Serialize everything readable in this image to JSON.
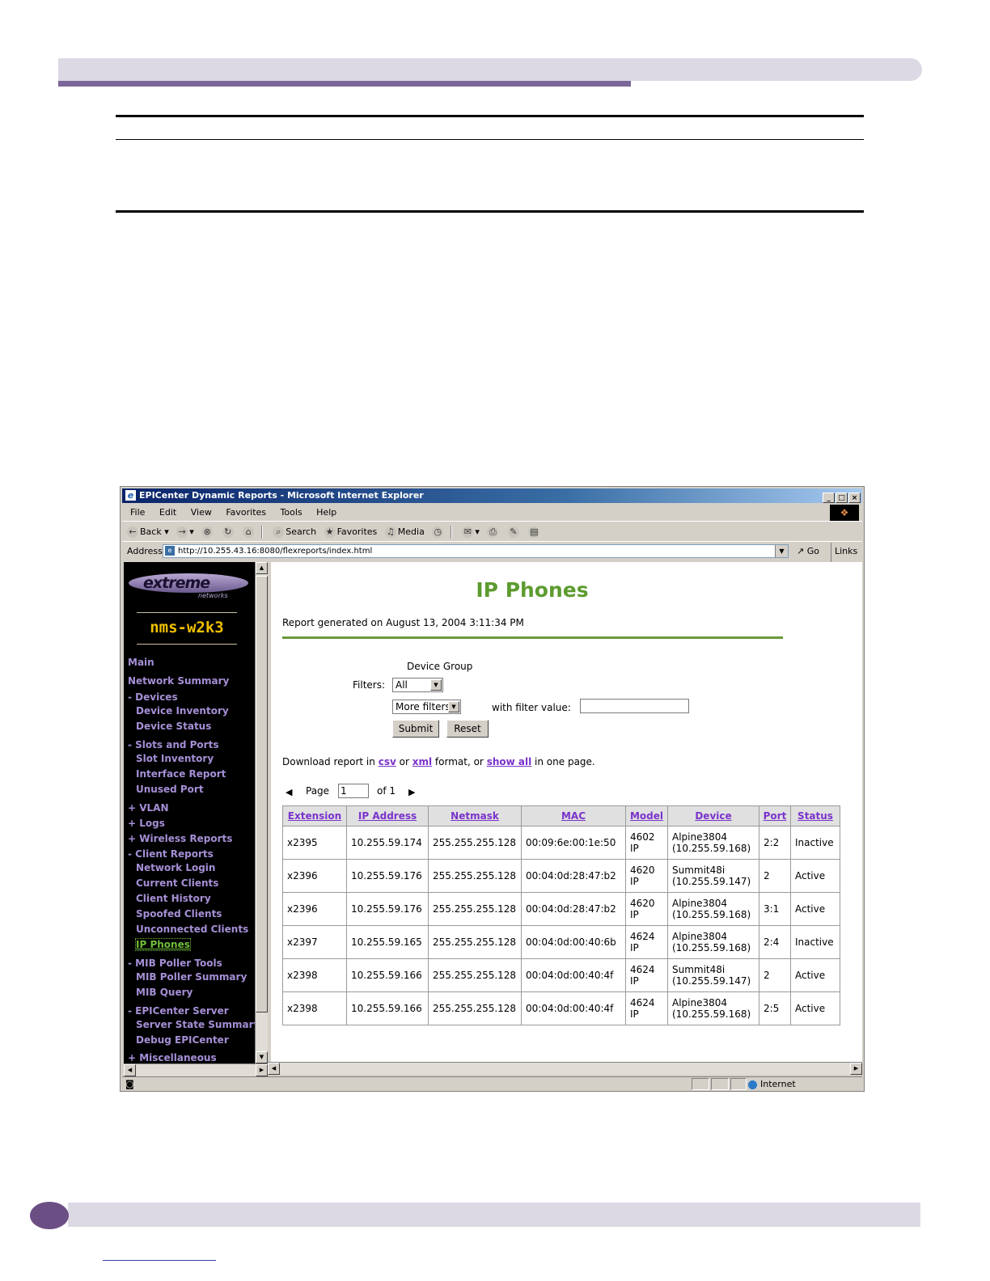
{
  "window": {
    "title": "EPICenter Dynamic Reports - Microsoft Internet Explorer"
  },
  "menu": [
    "File",
    "Edit",
    "View",
    "Favorites",
    "Tools",
    "Help"
  ],
  "toolbar": {
    "back": "Back",
    "search": "Search",
    "favorites": "Favorites",
    "media": "Media"
  },
  "address": {
    "label": "Address",
    "url": "http://10.255.43.16:8080/flexreports/index.html",
    "go": "Go",
    "links": "Links"
  },
  "sidebar": {
    "logo": "extreme",
    "logo_sub": "networks",
    "host": "nms-w2k3",
    "items": [
      {
        "label": "Main"
      },
      {
        "label": "Network Summary"
      },
      {
        "label": "- Devices"
      },
      {
        "label": "Device Inventory"
      },
      {
        "label": "Device Status"
      },
      {
        "label": "- Slots and Ports"
      },
      {
        "label": "Slot Inventory"
      },
      {
        "label": "Interface Report"
      },
      {
        "label": "Unused Port"
      },
      {
        "label": "+ VLAN"
      },
      {
        "label": "+ Logs"
      },
      {
        "label": "+ Wireless Reports"
      },
      {
        "label": "- Client Reports"
      },
      {
        "label": "Network Login"
      },
      {
        "label": "Current Clients"
      },
      {
        "label": "Client History"
      },
      {
        "label": "Spoofed Clients"
      },
      {
        "label": "Unconnected Clients"
      },
      {
        "label": "IP Phones"
      },
      {
        "label": "- MIB Poller Tools"
      },
      {
        "label": "MIB Poller Summary"
      },
      {
        "label": "MIB Query"
      },
      {
        "label": "- EPICenter Server"
      },
      {
        "label": "Server State Summary"
      },
      {
        "label": "Debug EPICenter"
      },
      {
        "label": "+ Miscellaneous"
      }
    ]
  },
  "report": {
    "title": "IP Phones",
    "generated": "Report generated on August 13, 2004 3:11:34 PM",
    "device_group_label": "Device Group",
    "filters_label": "Filters:",
    "filter_value": "All",
    "more_filters": "More filters",
    "with_filter_value": "with filter value:",
    "submit": "Submit",
    "reset": "Reset",
    "download_prefix": "Download report in",
    "csv": "csv",
    "or1": "or",
    "xml": "xml",
    "format_or": "format, or",
    "show_all": "show all",
    "one_page": "in one page.",
    "page_label": "Page",
    "page_value": "1",
    "of_label": "of 1",
    "columns": [
      "Extension",
      "IP Address",
      "Netmask",
      "MAC",
      "Model",
      "Device",
      "Port",
      "Status"
    ],
    "rows": [
      [
        "x2395",
        "10.255.59.174",
        "255.255.255.128",
        "00:09:6e:00:1e:50",
        "4602",
        "IP",
        "Alpine3804",
        "(10.255.59.168)",
        "2:2",
        "Inactive"
      ],
      [
        "x2396",
        "10.255.59.176",
        "255.255.255.128",
        "00:04:0d:28:47:b2",
        "4620",
        "IP",
        "Summit48i",
        "(10.255.59.147)",
        "2",
        "Active"
      ],
      [
        "x2396",
        "10.255.59.176",
        "255.255.255.128",
        "00:04:0d:28:47:b2",
        "4620",
        "IP",
        "Alpine3804",
        "(10.255.59.168)",
        "3:1",
        "Active"
      ],
      [
        "x2397",
        "10.255.59.165",
        "255.255.255.128",
        "00:04:0d:00:40:6b",
        "4624",
        "IP",
        "Alpine3804",
        "(10.255.59.168)",
        "2:4",
        "Inactive"
      ],
      [
        "x2398",
        "10.255.59.166",
        "255.255.255.128",
        "00:04:0d:00:40:4f",
        "4624",
        "IP",
        "Summit48i",
        "(10.255.59.147)",
        "2",
        "Active"
      ],
      [
        "x2398",
        "10.255.59.166",
        "255.255.255.128",
        "00:04:0d:00:40:4f",
        "4624",
        "IP",
        "Alpine3804",
        "(10.255.59.168)",
        "2:5",
        "Active"
      ]
    ]
  },
  "status": {
    "zone": "Internet"
  }
}
